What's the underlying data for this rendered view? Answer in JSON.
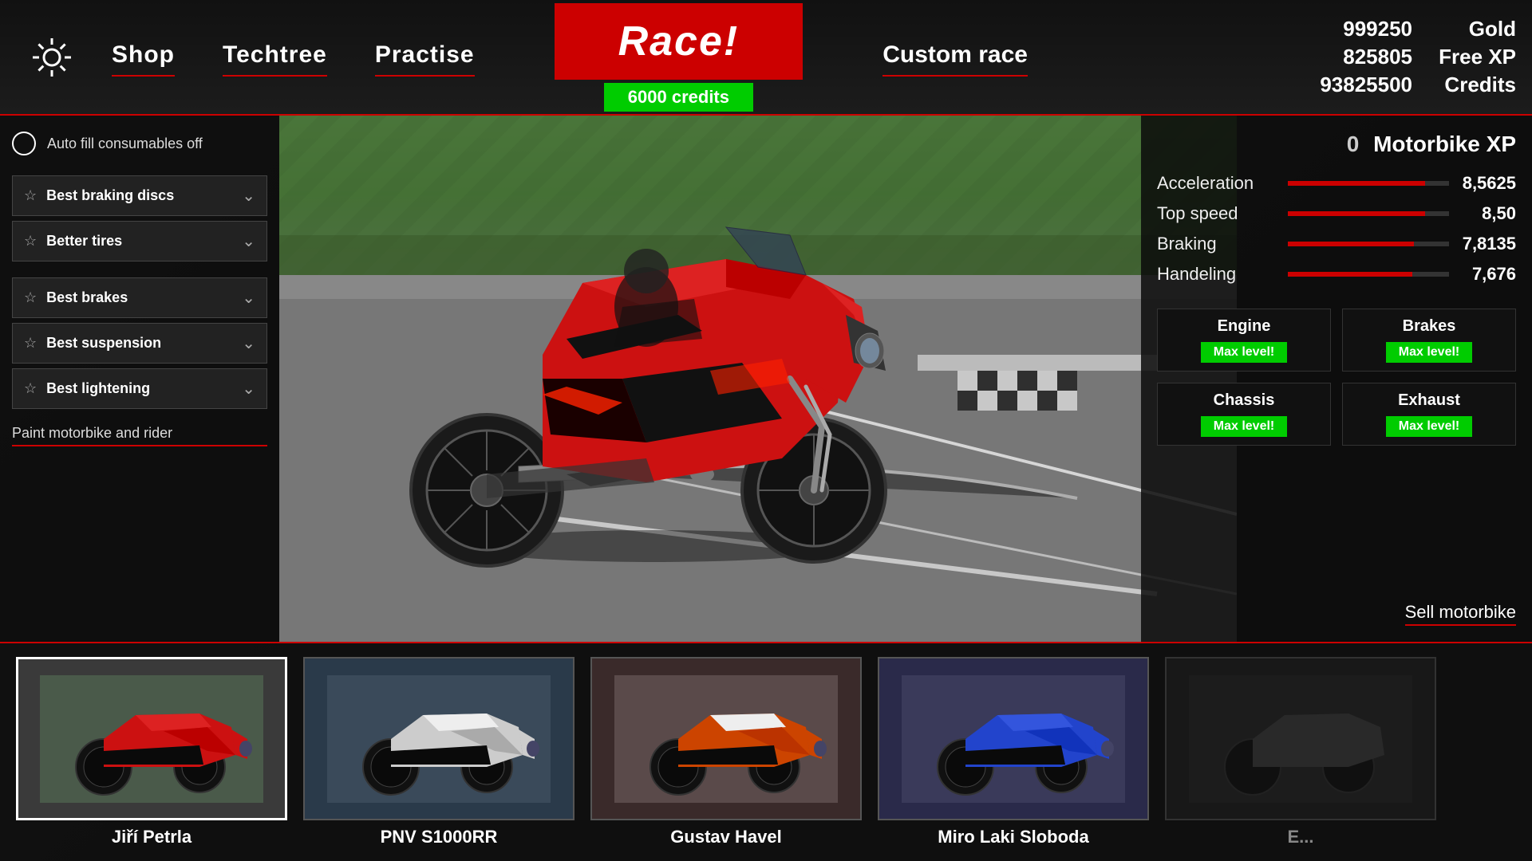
{
  "nav": {
    "shop_label": "Shop",
    "techtree_label": "Techtree",
    "practise_label": "Practise",
    "race_label": "Race!",
    "race_credits": "6000 credits",
    "custom_race_label": "Custom race"
  },
  "player_stats": {
    "gold_value": "999250",
    "gold_label": "Gold",
    "free_xp_value": "825805",
    "free_xp_label": "Free XP",
    "credits_value": "93825500",
    "credits_label": "Credits"
  },
  "motorbike": {
    "xp_value": "0",
    "xp_label": "Motorbike XP"
  },
  "auto_fill": {
    "label": "Auto fill consumables off"
  },
  "equipment": [
    {
      "name": "Best braking discs"
    },
    {
      "name": "Better tires"
    },
    {
      "name": "Best brakes"
    },
    {
      "name": "Best suspension"
    },
    {
      "name": "Best lightening"
    }
  ],
  "paint_link": "Paint motorbike and rider",
  "sell_link": "Sell motorbike",
  "bike_stats": [
    {
      "name": "Acceleration",
      "value": "8,5625",
      "pct": 85
    },
    {
      "name": "Top speed",
      "value": "8,50",
      "pct": 85
    },
    {
      "name": "Braking",
      "value": "7,8135",
      "pct": 78
    },
    {
      "name": "Handeling",
      "value": "7,676",
      "pct": 77
    }
  ],
  "components": [
    {
      "title": "Engine",
      "badge": "Max level!"
    },
    {
      "title": "Brakes",
      "badge": "Max level!"
    },
    {
      "title": "Chassis",
      "badge": "Max level!"
    },
    {
      "title": "Exhaust",
      "badge": "Max level!"
    }
  ],
  "bikes_row": [
    {
      "name": "Jiří Petrla",
      "color": "#cc2200",
      "bg": "#3a3a3a"
    },
    {
      "name": "PNV S1000RR",
      "color": "#cccccc",
      "bg": "#3a4a5a"
    },
    {
      "name": "Gustav Havel",
      "color": "#cc4400",
      "bg": "#4a3a3a"
    },
    {
      "name": "Miro Laki Sloboda",
      "color": "#2244cc",
      "bg": "#3a3a4a"
    },
    {
      "name": "E...",
      "color": "#444444",
      "bg": "#2a2a2a"
    }
  ]
}
